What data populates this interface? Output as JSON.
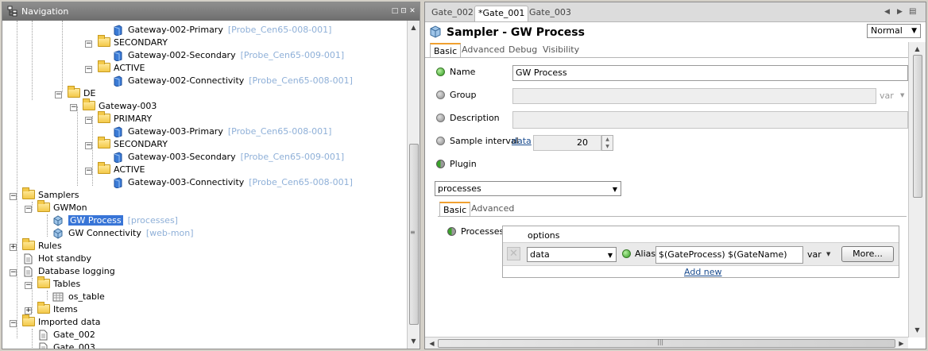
{
  "navigation": {
    "title": "Navigation",
    "header_buttons": [
      "□",
      "⊡",
      "✕"
    ],
    "tree": [
      {
        "label": "Gateway-002-Primary",
        "ref": "[Probe_Cen65-008-001]",
        "type": "gateway"
      },
      {
        "label": "SECONDARY",
        "ref": "",
        "type": "folder"
      },
      {
        "label": "Gateway-002-Secondary",
        "ref": "[Probe_Cen65-009-001]",
        "type": "gateway"
      },
      {
        "label": "ACTIVE",
        "ref": "",
        "type": "folder"
      },
      {
        "label": "Gateway-002-Connectivity",
        "ref": "[Probe_Cen65-008-001]",
        "type": "gateway"
      },
      {
        "label": "DE",
        "ref": "",
        "type": "folder"
      },
      {
        "label": "Gateway-003",
        "ref": "",
        "type": "folder"
      },
      {
        "label": "PRIMARY",
        "ref": "",
        "type": "folder"
      },
      {
        "label": "Gateway-003-Primary",
        "ref": "[Probe_Cen65-008-001]",
        "type": "gateway"
      },
      {
        "label": "SECONDARY",
        "ref": "",
        "type": "folder"
      },
      {
        "label": "Gateway-003-Secondary",
        "ref": "[Probe_Cen65-009-001]",
        "type": "gateway"
      },
      {
        "label": "ACTIVE",
        "ref": "",
        "type": "folder"
      },
      {
        "label": "Gateway-003-Connectivity",
        "ref": "[Probe_Cen65-008-001]",
        "type": "gateway"
      },
      {
        "label": "Samplers",
        "ref": "",
        "type": "folder"
      },
      {
        "label": "GWMon",
        "ref": "",
        "type": "folder"
      },
      {
        "label": "GW Process",
        "ref": "[processes]",
        "type": "sampler"
      },
      {
        "label": "GW Connectivity",
        "ref": "[web-mon]",
        "type": "sampler"
      },
      {
        "label": "Rules",
        "ref": "",
        "type": "folder"
      },
      {
        "label": "Hot standby",
        "ref": "",
        "type": "doc"
      },
      {
        "label": "Database logging",
        "ref": "",
        "type": "doc"
      },
      {
        "label": "Tables",
        "ref": "",
        "type": "folder"
      },
      {
        "label": "os_table",
        "ref": "",
        "type": "table"
      },
      {
        "label": "Items",
        "ref": "",
        "type": "folder"
      },
      {
        "label": "Imported data",
        "ref": "",
        "type": "folder"
      },
      {
        "label": "Gate_002",
        "ref": "",
        "type": "doc"
      },
      {
        "label": "Gate_003",
        "ref": "",
        "type": "doc"
      }
    ]
  },
  "editor": {
    "tabs": [
      "Gate_002",
      "*Gate_001",
      "Gate_003"
    ],
    "title": "Sampler - GW Process",
    "mode": "Normal",
    "subtabs": [
      "Basic",
      "Advanced",
      "Debug",
      "Visibility"
    ],
    "fields": {
      "name_label": "Name",
      "name_value": "GW Process",
      "group_label": "Group",
      "group_var": "var",
      "description_label": "Description",
      "sample_interval_label": "Sample interval",
      "sample_interval_link": "data",
      "sample_interval_value": "20",
      "plugin_label": "Plugin",
      "plugin_value": "processes"
    },
    "plugin_tabs": [
      "Basic",
      "Advanced"
    ],
    "processes": {
      "label": "Processes",
      "options_header": "options",
      "data_value": "data",
      "alias_label": "Alias",
      "alias_value": "$(GateProcess) $(GateName)",
      "var_label": "var",
      "more_button": "More...",
      "add_new": "Add new"
    }
  },
  "colors": {
    "selection": "#3875d7",
    "reference": "#8fb0d8",
    "accent_tab": "#f0a030"
  },
  "icons": [
    "navigation-icon",
    "folder-icon",
    "gateway-icon",
    "sampler-icon",
    "document-icon",
    "table-icon",
    "sampler-title-icon",
    "delete-icon",
    "status-green-icon",
    "status-gray-icon",
    "status-half-icon"
  ]
}
